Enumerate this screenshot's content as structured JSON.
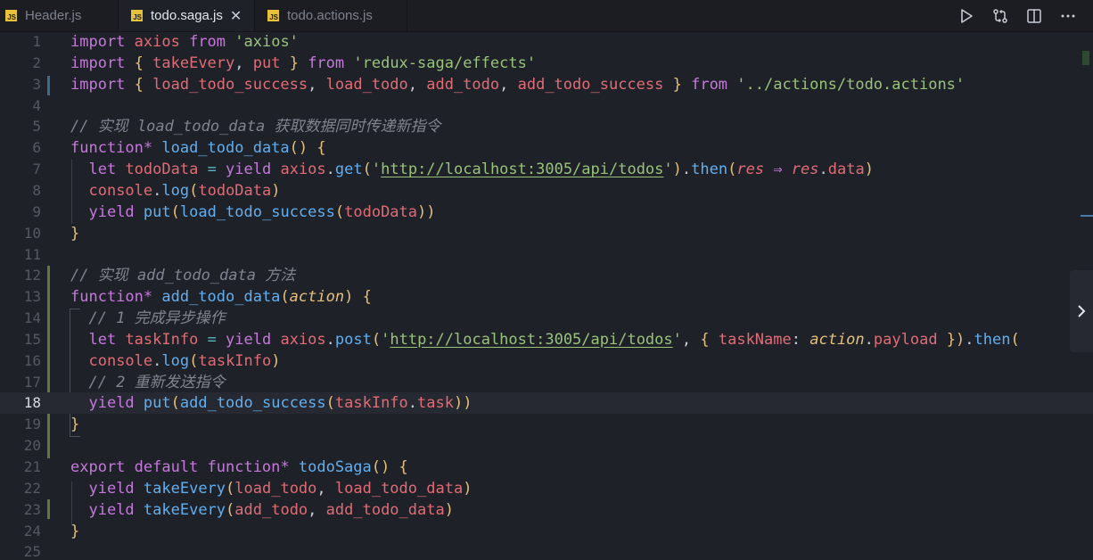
{
  "tabs": [
    {
      "name": "Header.js",
      "badge": "JS",
      "active": false
    },
    {
      "name": "todo.saga.js",
      "badge": "JS",
      "active": true
    },
    {
      "name": "todo.actions.js",
      "badge": "JS",
      "active": false
    }
  ],
  "tab_close_glyph": "✕",
  "icons": {
    "run": "run-icon",
    "compare": "compare-changes-icon",
    "split": "split-editor-icon",
    "more": "more-actions-icon",
    "expand": "chevron-right-icon"
  },
  "current_line": 18,
  "lines": [
    {
      "n": "1",
      "tokens": [
        [
          "k",
          "import "
        ],
        [
          "v",
          "axios "
        ],
        [
          "k",
          "from "
        ],
        [
          "s",
          "'axios'"
        ]
      ]
    },
    {
      "n": "2",
      "tokens": [
        [
          "k",
          "import "
        ],
        [
          "p",
          "{ "
        ],
        [
          "v",
          "takeEvery"
        ],
        [
          "t",
          ", "
        ],
        [
          "v",
          "put "
        ],
        [
          "p",
          "} "
        ],
        [
          "k",
          "from "
        ],
        [
          "s",
          "'redux-saga/effects'"
        ]
      ]
    },
    {
      "n": "3",
      "tokens": [
        [
          "k",
          "import "
        ],
        [
          "p",
          "{ "
        ],
        [
          "v",
          "load_todo_success"
        ],
        [
          "t",
          ", "
        ],
        [
          "v",
          "load_todo"
        ],
        [
          "t",
          ", "
        ],
        [
          "v",
          "add_todo"
        ],
        [
          "t",
          ", "
        ],
        [
          "v",
          "add_todo_success "
        ],
        [
          "p",
          "} "
        ],
        [
          "k",
          "from "
        ],
        [
          "s",
          "'../actions/todo.actions'"
        ]
      ]
    },
    {
      "n": "4",
      "tokens": []
    },
    {
      "n": "5",
      "tokens": [
        [
          "c",
          "// 实现 load_todo_data 获取数据同时传递新指令"
        ]
      ]
    },
    {
      "n": "6",
      "tokens": [
        [
          "k",
          "function* "
        ],
        [
          "f",
          "load_todo_data"
        ],
        [
          "p",
          "() {"
        ]
      ]
    },
    {
      "n": "7",
      "tokens": [
        [
          "t",
          "  "
        ],
        [
          "k",
          "let "
        ],
        [
          "v",
          "todoData "
        ],
        [
          "o",
          "= "
        ],
        [
          "k",
          "yield "
        ],
        [
          "v",
          "axios"
        ],
        [
          "t",
          "."
        ],
        [
          "f",
          "get"
        ],
        [
          "p",
          "("
        ],
        [
          "s",
          "'"
        ],
        [
          "u",
          "http://localhost:3005/api/todos"
        ],
        [
          "s",
          "'"
        ],
        [
          "p",
          ")"
        ],
        [
          "t",
          "."
        ],
        [
          "f",
          "then"
        ],
        [
          "p",
          "("
        ],
        [
          "pa",
          "res "
        ],
        [
          "k",
          "⇒ "
        ],
        [
          "pa",
          "res"
        ],
        [
          "t",
          "."
        ],
        [
          "v",
          "data"
        ],
        [
          "p",
          ")"
        ]
      ]
    },
    {
      "n": "8",
      "tokens": [
        [
          "t",
          "  "
        ],
        [
          "v",
          "console"
        ],
        [
          "t",
          "."
        ],
        [
          "f",
          "log"
        ],
        [
          "p",
          "("
        ],
        [
          "v",
          "todoData"
        ],
        [
          "p",
          ")"
        ]
      ]
    },
    {
      "n": "9",
      "tokens": [
        [
          "t",
          "  "
        ],
        [
          "k",
          "yield "
        ],
        [
          "f",
          "put"
        ],
        [
          "p",
          "("
        ],
        [
          "f",
          "load_todo_success"
        ],
        [
          "p",
          "("
        ],
        [
          "v",
          "todoData"
        ],
        [
          "p",
          "))"
        ]
      ]
    },
    {
      "n": "10",
      "tokens": [
        [
          "p",
          "}"
        ]
      ]
    },
    {
      "n": "11",
      "tokens": []
    },
    {
      "n": "12",
      "tokens": [
        [
          "c",
          "// 实现 add_todo_data 方法"
        ]
      ]
    },
    {
      "n": "13",
      "tokens": [
        [
          "k",
          "function* "
        ],
        [
          "f",
          "add_todo_data"
        ],
        [
          "p",
          "("
        ],
        [
          "pr",
          "action"
        ],
        [
          "p",
          ") {"
        ]
      ]
    },
    {
      "n": "14",
      "tokens": [
        [
          "c",
          "  // 1 完成异步操作"
        ]
      ]
    },
    {
      "n": "15",
      "tokens": [
        [
          "t",
          "  "
        ],
        [
          "k",
          "let "
        ],
        [
          "v",
          "taskInfo "
        ],
        [
          "o",
          "= "
        ],
        [
          "k",
          "yield "
        ],
        [
          "v",
          "axios"
        ],
        [
          "t",
          "."
        ],
        [
          "f",
          "post"
        ],
        [
          "p",
          "("
        ],
        [
          "s",
          "'"
        ],
        [
          "u",
          "http://localhost:3005/api/todos"
        ],
        [
          "s",
          "'"
        ],
        [
          "t",
          ", "
        ],
        [
          "p",
          "{ "
        ],
        [
          "v",
          "taskName"
        ],
        [
          "t",
          ": "
        ],
        [
          "pr",
          "action"
        ],
        [
          "t",
          "."
        ],
        [
          "v",
          "payload "
        ],
        [
          "p",
          "})"
        ],
        [
          "t",
          "."
        ],
        [
          "f",
          "then"
        ],
        [
          "p",
          "("
        ]
      ]
    },
    {
      "n": "16",
      "tokens": [
        [
          "t",
          "  "
        ],
        [
          "v",
          "console"
        ],
        [
          "t",
          "."
        ],
        [
          "f",
          "log"
        ],
        [
          "p",
          "("
        ],
        [
          "v",
          "taskInfo"
        ],
        [
          "p",
          ")"
        ]
      ]
    },
    {
      "n": "17",
      "tokens": [
        [
          "c",
          "  // 2 重新发送指令"
        ]
      ]
    },
    {
      "n": "18",
      "tokens": [
        [
          "t",
          "  "
        ],
        [
          "k",
          "yield "
        ],
        [
          "f",
          "put"
        ],
        [
          "p",
          "("
        ],
        [
          "f",
          "add_todo_success"
        ],
        [
          "p",
          "("
        ],
        [
          "v",
          "taskInfo"
        ],
        [
          "t",
          "."
        ],
        [
          "v",
          "task"
        ],
        [
          "p",
          "))"
        ]
      ]
    },
    {
      "n": "19",
      "tokens": [
        [
          "p",
          "}"
        ]
      ]
    },
    {
      "n": "20",
      "tokens": []
    },
    {
      "n": "21",
      "tokens": [
        [
          "k",
          "export default function* "
        ],
        [
          "f",
          "todoSaga"
        ],
        [
          "p",
          "() {"
        ]
      ]
    },
    {
      "n": "22",
      "tokens": [
        [
          "t",
          "  "
        ],
        [
          "k",
          "yield "
        ],
        [
          "f",
          "takeEvery"
        ],
        [
          "p",
          "("
        ],
        [
          "v",
          "load_todo"
        ],
        [
          "t",
          ", "
        ],
        [
          "v",
          "load_todo_data"
        ],
        [
          "p",
          ")"
        ]
      ]
    },
    {
      "n": "23",
      "tokens": [
        [
          "t",
          "  "
        ],
        [
          "k",
          "yield "
        ],
        [
          "f",
          "takeEvery"
        ],
        [
          "p",
          "("
        ],
        [
          "v",
          "add_todo"
        ],
        [
          "t",
          ", "
        ],
        [
          "v",
          "add_todo_data"
        ],
        [
          "p",
          ")"
        ]
      ]
    },
    {
      "n": "24",
      "tokens": [
        [
          "p",
          "}"
        ]
      ]
    },
    {
      "n": "25",
      "tokens": []
    }
  ]
}
